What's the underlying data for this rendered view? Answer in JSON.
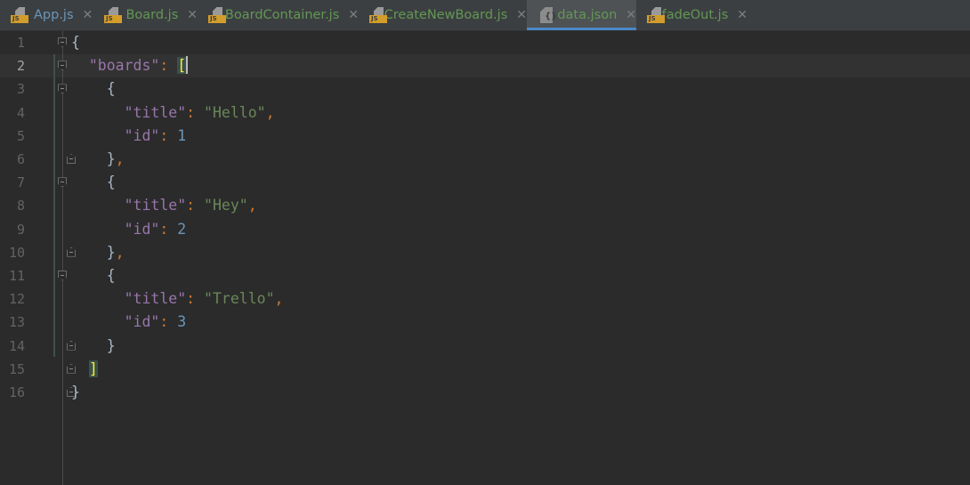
{
  "tabs": [
    {
      "label": "App.js",
      "icon": "js-file-icon",
      "color": "blue"
    },
    {
      "label": "Board.js",
      "icon": "js-file-icon",
      "color": "green"
    },
    {
      "label": "BoardContainer.js",
      "icon": "js-file-icon",
      "color": "green"
    },
    {
      "label": "CreateNewBoard.js",
      "icon": "js-file-icon",
      "color": "green"
    },
    {
      "label": "data.json",
      "icon": "json-file-icon",
      "color": "green",
      "active": true
    },
    {
      "label": "fadeOut.js",
      "icon": "js-file-icon",
      "color": "green"
    }
  ],
  "icon_text": {
    "js": "JS",
    "json": "{}"
  },
  "current_line": 2,
  "lines": [
    {
      "n": "1",
      "fold": "open",
      "tokens": [
        [
          "{",
          "b"
        ]
      ]
    },
    {
      "n": "2",
      "fold": "open",
      "tokens": [
        [
          "  ",
          ""
        ],
        [
          "\"boards\"",
          "k"
        ],
        [
          ": ",
          "p"
        ],
        [
          "[",
          "m"
        ]
      ],
      "caret": true
    },
    {
      "n": "3",
      "fold": "open",
      "tokens": [
        [
          "    {",
          "b"
        ]
      ]
    },
    {
      "n": "4",
      "tokens": [
        [
          "      ",
          ""
        ],
        [
          "\"title\"",
          "k"
        ],
        [
          ": ",
          "p"
        ],
        [
          "\"Hello\"",
          "s"
        ],
        [
          ",",
          "p"
        ]
      ]
    },
    {
      "n": "5",
      "tokens": [
        [
          "      ",
          ""
        ],
        [
          "\"id\"",
          "k"
        ],
        [
          ": ",
          "p"
        ],
        [
          "1",
          "n"
        ]
      ]
    },
    {
      "n": "6",
      "fold": "close",
      "tokens": [
        [
          "    }",
          "b"
        ],
        [
          ",",
          "p"
        ]
      ]
    },
    {
      "n": "7",
      "fold": "open",
      "tokens": [
        [
          "    {",
          "b"
        ]
      ]
    },
    {
      "n": "8",
      "tokens": [
        [
          "      ",
          ""
        ],
        [
          "\"title\"",
          "k"
        ],
        [
          ": ",
          "p"
        ],
        [
          "\"Hey\"",
          "s"
        ],
        [
          ",",
          "p"
        ]
      ]
    },
    {
      "n": "9",
      "tokens": [
        [
          "      ",
          ""
        ],
        [
          "\"id\"",
          "k"
        ],
        [
          ": ",
          "p"
        ],
        [
          "2",
          "n"
        ]
      ]
    },
    {
      "n": "10",
      "fold": "close",
      "tokens": [
        [
          "    }",
          "b"
        ],
        [
          ",",
          "p"
        ]
      ]
    },
    {
      "n": "11",
      "fold": "open",
      "tokens": [
        [
          "    {",
          "b"
        ]
      ]
    },
    {
      "n": "12",
      "tokens": [
        [
          "      ",
          ""
        ],
        [
          "\"title\"",
          "k"
        ],
        [
          ": ",
          "p"
        ],
        [
          "\"Trello\"",
          "s"
        ],
        [
          ",",
          "p"
        ]
      ]
    },
    {
      "n": "13",
      "tokens": [
        [
          "      ",
          ""
        ],
        [
          "\"id\"",
          "k"
        ],
        [
          ": ",
          "p"
        ],
        [
          "3",
          "n"
        ]
      ]
    },
    {
      "n": "14",
      "fold": "close",
      "tokens": [
        [
          "    }",
          "b"
        ]
      ]
    },
    {
      "n": "15",
      "fold": "close",
      "tokens": [
        [
          "  ",
          ""
        ],
        [
          "]",
          "m"
        ]
      ]
    },
    {
      "n": "16",
      "fold": "close",
      "tokens": [
        [
          "}",
          "b"
        ]
      ]
    }
  ]
}
